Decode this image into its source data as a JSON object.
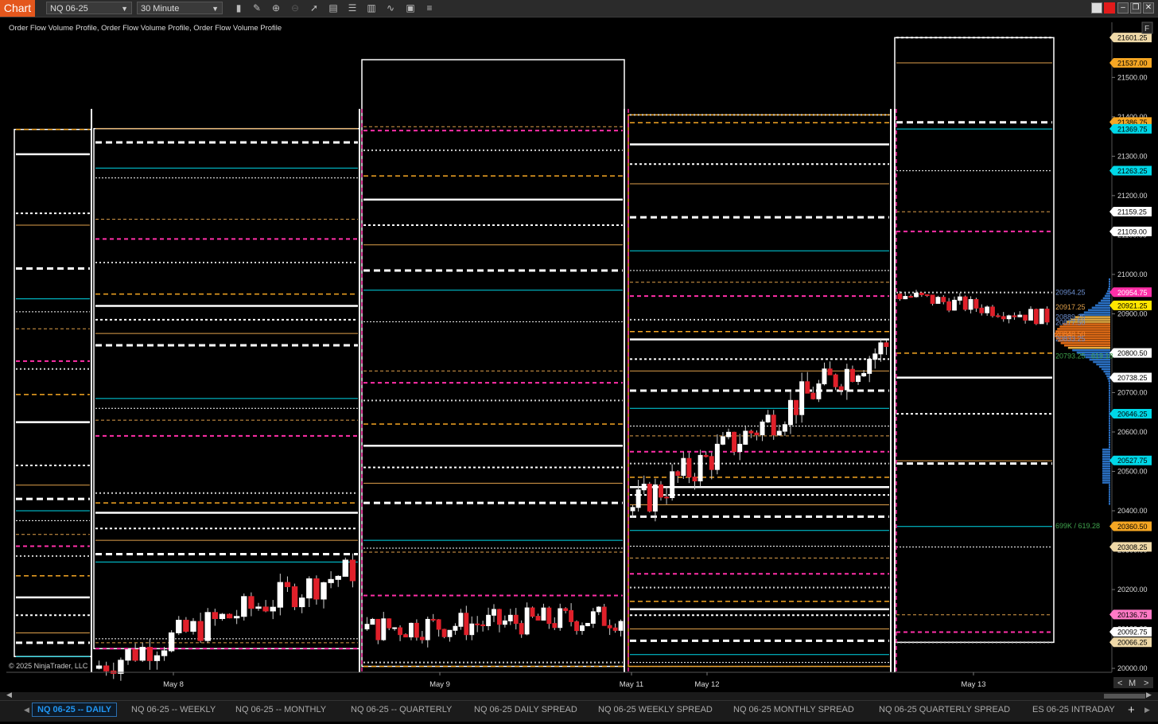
{
  "toolbar": {
    "app_title": "Chart",
    "instrument": "NQ 06-25",
    "interval": "30 Minute",
    "tools": [
      "bar-type-icon",
      "draw-icon",
      "zoom-in-icon",
      "zoom-out-icon",
      "pointer-icon",
      "data-box-icon",
      "properties-icon",
      "strategy-icon",
      "indicator-icon",
      "template-icon",
      "list-icon"
    ]
  },
  "chart": {
    "indicator_title": "Order Flow Volume Profile, Order Flow Volume Profile, Order Flow Volume Profile",
    "copyright": "© 2025 NinjaTrader, LLC",
    "f_button": "F",
    "scroll_controls": [
      "<",
      "M",
      ">"
    ],
    "vp_labels": [
      {
        "text": "20954.25",
        "price": 20954.25,
        "color": "#6d8fcf"
      },
      {
        "text": "20917.25",
        "price": 20917.25,
        "color": "#e0a14b"
      },
      {
        "text": "20889.25",
        "price": 20892,
        "color": "#6d8fcf"
      },
      {
        "text": "20877.50",
        "price": 20877.5,
        "color": "#6d8fcf"
      },
      {
        "text": "20848.50",
        "price": 20848.5,
        "color": "#ff8b2f"
      },
      {
        "text": "20833.25",
        "price": 20836,
        "color": "#6d8fcf"
      },
      {
        "text": "20793.25",
        "price": 20793.25,
        "color": "#3fa34d"
      },
      {
        "text": "619.18",
        "price": 20793.25,
        "color": "#3fa34d"
      },
      {
        "text": "699K / 619.28",
        "price": 20362,
        "color": "#3fa34d"
      }
    ]
  },
  "chart_data": {
    "type": "candlestick",
    "instrument": "NQ 06-25",
    "interval": "30 Minute",
    "ylim": [
      19990,
      21640
    ],
    "y_ticks": [
      20000,
      20100,
      20200,
      20300,
      20400,
      20500,
      20600,
      20700,
      20800,
      20900,
      21000,
      21100,
      21200,
      21300,
      21400,
      21500
    ],
    "y_tick_labels": [
      "20000.00",
      "20100.00",
      "20200.00",
      "20300.00",
      "20400.00",
      "20500.00",
      "20600.00",
      "20700.00",
      "20800.00",
      "20900.00",
      "21000.00",
      "21100.00",
      "21200.00",
      "21300.00",
      "21400.00",
      "21500.00"
    ],
    "x_tick_labels": [
      "May 8",
      "May 9",
      "May 11",
      "May 12",
      "May 13"
    ],
    "price_markers": [
      {
        "label": "21601.25",
        "value": 21601.25,
        "bg": "#efd9a8",
        "fg": "#000"
      },
      {
        "label": "21537.00",
        "value": 21537.0,
        "bg": "#f5a623",
        "fg": "#000"
      },
      {
        "label": "21386.75",
        "value": 21386.75,
        "bg": "#f5a623",
        "fg": "#000"
      },
      {
        "label": "21369.75",
        "value": 21369.75,
        "bg": "#00d8e8",
        "fg": "#000"
      },
      {
        "label": "21263.25",
        "value": 21263.25,
        "bg": "#00d8e8",
        "fg": "#000"
      },
      {
        "label": "21159.25",
        "value": 21159.25,
        "bg": "#ffffff",
        "fg": "#000"
      },
      {
        "label": "21109.00",
        "value": 21109.0,
        "bg": "#ffffff",
        "fg": "#000"
      },
      {
        "label": "20954.75",
        "value": 20954.75,
        "bg": "#ff2fa8",
        "fg": "#fff"
      },
      {
        "label": "20921.25",
        "value": 20921.25,
        "bg": "#ffe600",
        "fg": "#000"
      },
      {
        "label": "20800.50",
        "value": 20800.5,
        "bg": "#ffffff",
        "fg": "#000"
      },
      {
        "label": "20738.25",
        "value": 20738.25,
        "bg": "#ffffff",
        "fg": "#000"
      },
      {
        "label": "20646.25",
        "value": 20646.25,
        "bg": "#00d8e8",
        "fg": "#000"
      },
      {
        "label": "20527.75",
        "value": 20527.75,
        "bg": "#00d8e8",
        "fg": "#000"
      },
      {
        "label": "20360.50",
        "value": 20360.5,
        "bg": "#f5a623",
        "fg": "#000"
      },
      {
        "label": "20308.25",
        "value": 20308.25,
        "bg": "#efd9a8",
        "fg": "#000"
      },
      {
        "label": "20136.75",
        "value": 20136.75,
        "bg": "#ff7ac6",
        "fg": "#000"
      },
      {
        "label": "20092.75",
        "value": 20092.75,
        "bg": "#ffffff",
        "fg": "#000"
      },
      {
        "label": "20066.25",
        "value": 20066.25,
        "bg": "#efd9a8",
        "fg": "#000"
      }
    ],
    "candle_segments": [
      {
        "session": "May 8",
        "start": 20000,
        "end": 20250,
        "count": 36,
        "jitter": 40
      },
      {
        "session": "May 9",
        "start": 20100,
        "end": 20130,
        "count": 47,
        "jitter": 35
      },
      {
        "session": "May 11-12",
        "start": 20400,
        "end": 20820,
        "count": 46,
        "jitter": 45
      },
      {
        "session": "May 13",
        "start": 20950,
        "end": 20890,
        "count": 28,
        "jitter": 20
      }
    ],
    "profiles": [
      {
        "session": "pre",
        "levels": [
          21368,
          21305,
          21155,
          21125,
          21015,
          20938,
          20905,
          20862,
          20780,
          20760,
          20695,
          20625,
          20515,
          20465,
          20430,
          20400,
          20375,
          20340,
          20310,
          20285,
          20235,
          20180,
          20135,
          20090,
          20065,
          20030
        ]
      },
      {
        "session": "May 8",
        "levels": [
          21370,
          21335,
          21270,
          21245,
          21140,
          21090,
          21030,
          20950,
          20920,
          20885,
          20850,
          20820,
          20685,
          20660,
          20630,
          20590,
          20445,
          20420,
          20395,
          20355,
          20325,
          20290,
          20270,
          20075,
          20065,
          20050
        ]
      },
      {
        "session": "May 9",
        "levels": [
          21545,
          21375,
          21365,
          21315,
          21250,
          21190,
          21125,
          21075,
          21010,
          20960,
          20880,
          20755,
          20725,
          20680,
          20620,
          20565,
          20510,
          20470,
          20420,
          20325,
          20305,
          20295,
          20185,
          20015,
          20005
        ]
      },
      {
        "session": "May 11-12",
        "levels": [
          21405,
          21385,
          21330,
          21280,
          21230,
          21145,
          21060,
          21010,
          20980,
          20945,
          20885,
          20855,
          20835,
          20785,
          20755,
          20705,
          20660,
          20615,
          20590,
          20550,
          20520,
          20485,
          20460,
          20440,
          20415,
          20385,
          20350,
          20310,
          20280,
          20240,
          20205,
          20170,
          20150,
          20135,
          20100,
          20070,
          20035,
          20015,
          20005
        ]
      },
      {
        "session": "May 13",
        "levels": [
          21601,
          21537,
          21386,
          21369,
          21263,
          21159,
          21109,
          20954,
          20800,
          20738,
          20646,
          20527,
          20520,
          20360,
          20308,
          20136,
          20092,
          20066
        ]
      }
    ]
  },
  "tabs": [
    {
      "label": "NQ 06-25 -- DAILY",
      "active": true
    },
    {
      "label": "NQ 06-25 -- WEEKLY",
      "active": false
    },
    {
      "label": "NQ 06-25 -- MONTHLY",
      "active": false
    },
    {
      "label": "NQ 06-25 -- QUARTERLY",
      "active": false
    },
    {
      "label": "NQ 06-25 DAILY SPREAD",
      "active": false
    },
    {
      "label": "NQ 06-25 WEEKLY SPREAD",
      "active": false
    },
    {
      "label": "NQ 06-25 MONTHLY SPREAD",
      "active": false
    },
    {
      "label": "NQ 06-25 QUARTERLY SPREAD",
      "active": false
    },
    {
      "label": "ES 06-25 INTRADAY",
      "active": false
    }
  ],
  "tab_add": "+"
}
